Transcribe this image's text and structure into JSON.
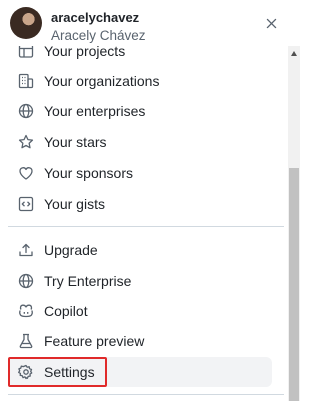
{
  "user": {
    "username": "aracelychavez",
    "full_name": "Aracely Chávez"
  },
  "menu": {
    "items": [
      {
        "label": "Your projects",
        "icon": "table-icon"
      },
      {
        "label": "Your organizations",
        "icon": "organization-icon"
      },
      {
        "label": "Your enterprises",
        "icon": "globe-icon"
      },
      {
        "label": "Your stars",
        "icon": "star-icon"
      },
      {
        "label": "Your sponsors",
        "icon": "heart-icon"
      },
      {
        "label": "Your gists",
        "icon": "code-square-icon"
      },
      {
        "label": "Upgrade",
        "icon": "upload-icon"
      },
      {
        "label": "Try Enterprise",
        "icon": "globe-icon"
      },
      {
        "label": "Copilot",
        "icon": "copilot-icon"
      },
      {
        "label": "Feature preview",
        "icon": "beaker-icon"
      },
      {
        "label": "Settings",
        "icon": "gear-icon"
      }
    ]
  },
  "colors": {
    "highlight_border": "#e02a2a",
    "selected_bg": "#f2f3f5",
    "text": "#1f2328",
    "muted": "#59636e"
  }
}
